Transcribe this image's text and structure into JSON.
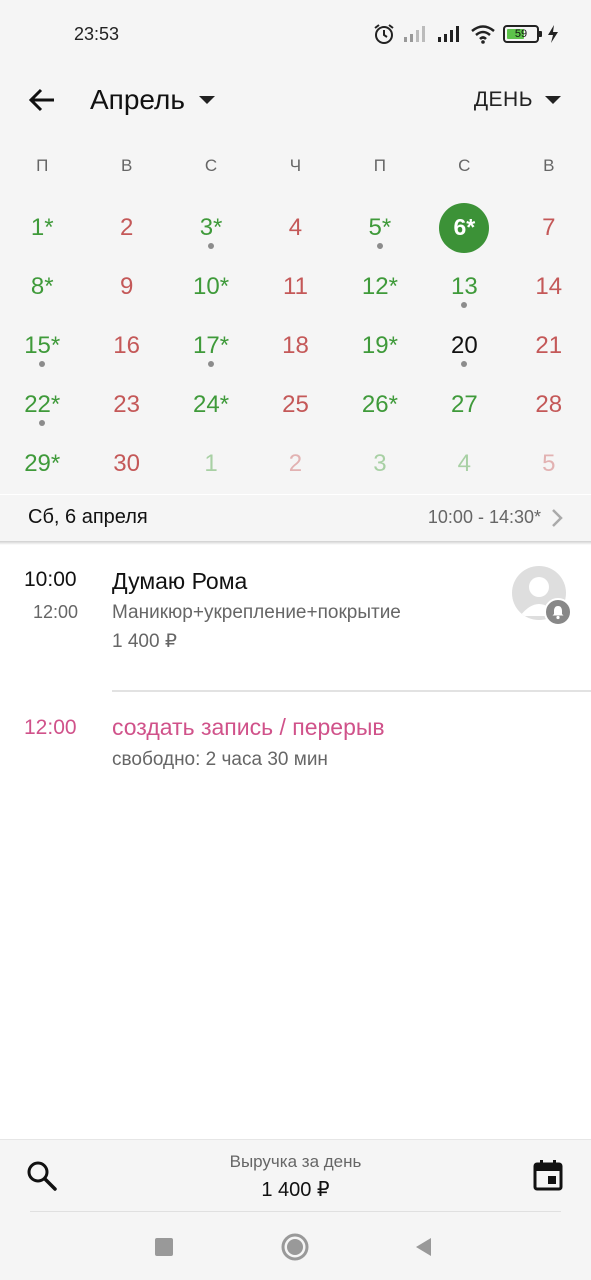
{
  "status_bar": {
    "time": "23:53",
    "battery_level": "59",
    "battery_fraction": 0.59,
    "icons": [
      "alarm-icon",
      "signal-weak-icon",
      "signal-icon",
      "wifi-icon",
      "battery-icon",
      "charging-icon"
    ]
  },
  "header": {
    "back_icon": "arrow-left-icon",
    "month": "Апрель",
    "view_mode": "ДЕНЬ"
  },
  "calendar": {
    "weekdays": [
      "П",
      "В",
      "С",
      "Ч",
      "П",
      "С",
      "В"
    ],
    "days": [
      {
        "label": "1*",
        "color": "green",
        "dot": false
      },
      {
        "label": "2",
        "color": "red",
        "dot": false
      },
      {
        "label": "3*",
        "color": "green",
        "dot": true
      },
      {
        "label": "4",
        "color": "red",
        "dot": false
      },
      {
        "label": "5*",
        "color": "green",
        "dot": true
      },
      {
        "label": "6*",
        "color": "selected",
        "dot": false
      },
      {
        "label": "7",
        "color": "red",
        "dot": false
      },
      {
        "label": "8*",
        "color": "green",
        "dot": false
      },
      {
        "label": "9",
        "color": "red",
        "dot": false
      },
      {
        "label": "10*",
        "color": "green",
        "dot": false
      },
      {
        "label": "11",
        "color": "red",
        "dot": false
      },
      {
        "label": "12*",
        "color": "green",
        "dot": false
      },
      {
        "label": "13",
        "color": "green",
        "dot": true
      },
      {
        "label": "14",
        "color": "red",
        "dot": false
      },
      {
        "label": "15*",
        "color": "green",
        "dot": true
      },
      {
        "label": "16",
        "color": "red",
        "dot": false
      },
      {
        "label": "17*",
        "color": "green",
        "dot": true
      },
      {
        "label": "18",
        "color": "red",
        "dot": false
      },
      {
        "label": "19*",
        "color": "green",
        "dot": false
      },
      {
        "label": "20",
        "color": "black",
        "dot": true
      },
      {
        "label": "21",
        "color": "red",
        "dot": false
      },
      {
        "label": "22*",
        "color": "green",
        "dot": true
      },
      {
        "label": "23",
        "color": "red",
        "dot": false
      },
      {
        "label": "24*",
        "color": "green",
        "dot": false
      },
      {
        "label": "25",
        "color": "red",
        "dot": false
      },
      {
        "label": "26*",
        "color": "green",
        "dot": false
      },
      {
        "label": "27",
        "color": "green",
        "dot": false
      },
      {
        "label": "28",
        "color": "red",
        "dot": false
      },
      {
        "label": "29*",
        "color": "green",
        "dot": false
      },
      {
        "label": "30",
        "color": "red",
        "dot": false
      },
      {
        "label": "1",
        "color": "faded-green",
        "dot": false
      },
      {
        "label": "2",
        "color": "faded-red",
        "dot": false
      },
      {
        "label": "3",
        "color": "faded-green",
        "dot": false
      },
      {
        "label": "4",
        "color": "faded-green",
        "dot": false
      },
      {
        "label": "5",
        "color": "faded-red",
        "dot": false
      }
    ],
    "selected_date": "Сб, 6 апреля",
    "work_hours": "10:00 - 14:30*"
  },
  "schedule": {
    "appointment": {
      "start": "10:00",
      "end": "12:00",
      "client": "Думаю Рома",
      "service": "Маникюр+укрепление+покрытие",
      "price": "1 400 ₽",
      "avatar_icon": "person-avatar-icon",
      "badge_icon": "bell-icon"
    },
    "free_slot": {
      "time": "12:00",
      "action": "создать запись / перерыв",
      "duration": "свободно: 2 часа 30 мин"
    }
  },
  "bottom_bar": {
    "search_icon": "search-icon",
    "revenue_label": "Выручка за день",
    "revenue_value": "1 400 ₽",
    "calendar_icon": "calendar-today-icon"
  },
  "nav_bar": {
    "icons": [
      "recents-square-icon",
      "home-circle-icon",
      "back-triangle-icon"
    ]
  },
  "colors": {
    "accent_green": "#3c9237",
    "weekend_red": "#c45858",
    "free_slot_pink": "#d0528a",
    "battery_green": "#5cc24a"
  }
}
